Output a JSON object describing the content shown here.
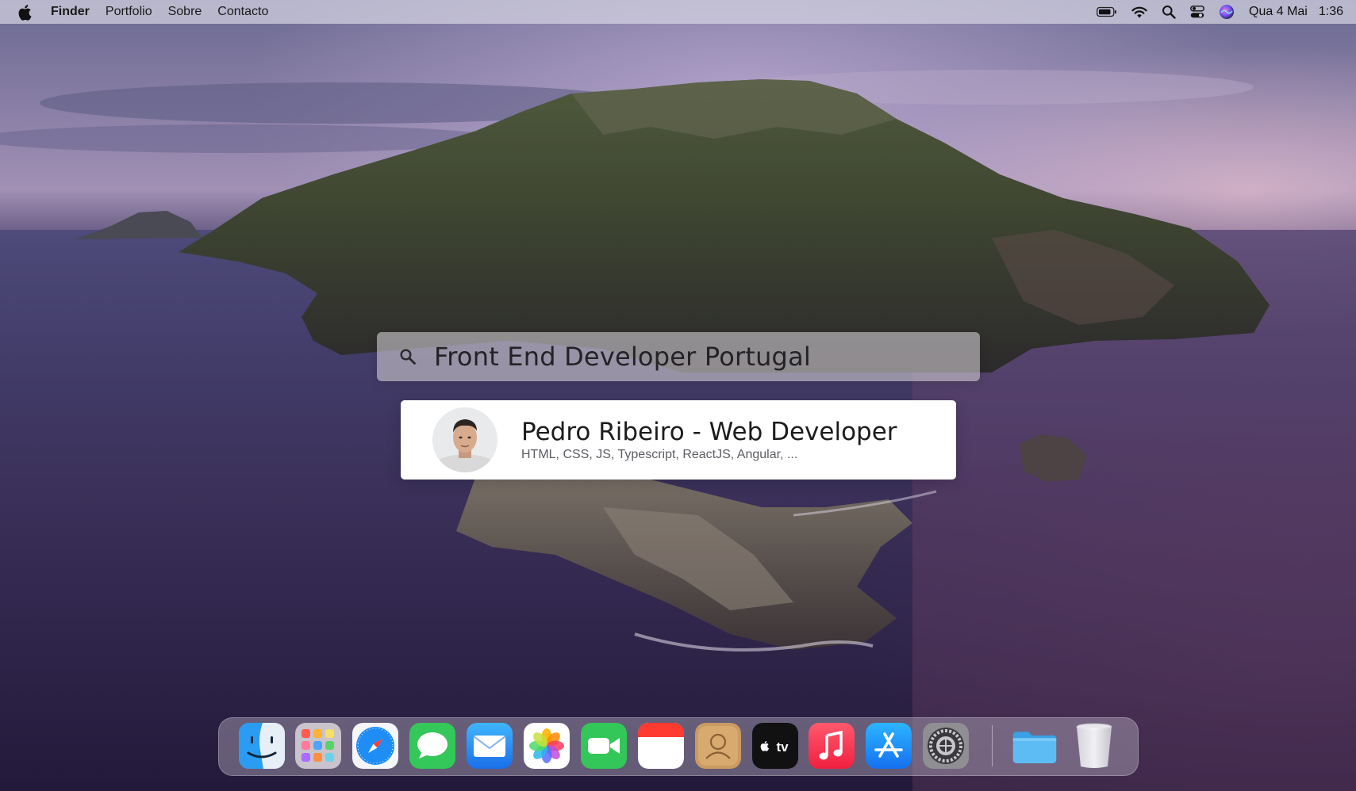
{
  "menubar": {
    "app_name": "Finder",
    "items": [
      "Portfolio",
      "Sobre",
      "Contacto"
    ],
    "status_icons": [
      "battery-icon",
      "wifi-icon",
      "spotlight-search-icon",
      "control-center-icon",
      "siri-icon"
    ],
    "date": "Qua 4 Mai",
    "time": "1:36"
  },
  "spotlight": {
    "query": "Front End Developer Portugal",
    "result": {
      "title": "Pedro Ribeiro - Web Developer",
      "subtitle": "HTML, CSS, JS, Typescript, ReactJS, Angular, ..."
    }
  },
  "dock": {
    "apps": [
      "finder-icon",
      "launchpad-icon",
      "safari-icon",
      "messages-icon",
      "mail-icon",
      "photos-icon",
      "facetime-icon",
      "calendar-icon",
      "contacts-icon",
      "apple-tv-icon",
      "music-icon",
      "app-store-icon",
      "system-preferences-icon"
    ],
    "extras": [
      "downloads-folder-icon",
      "trash-icon"
    ],
    "tv_label": "tv"
  },
  "colors": {
    "menubar_bg": "#d6d4e2",
    "result_bg": "#ffffff",
    "messages_green": "#34c759",
    "music_red": "#fa2d48",
    "appstore_blue": "#1c8ef9"
  }
}
